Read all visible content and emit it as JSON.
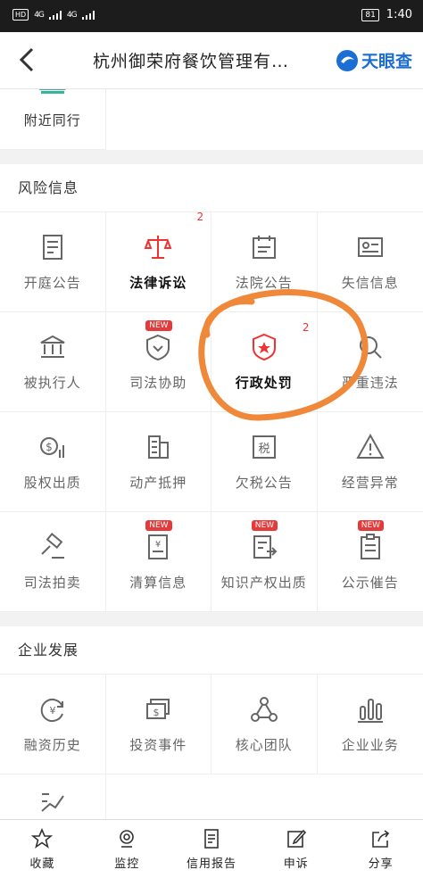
{
  "status_bar": {
    "hd": "HD",
    "sig1": "4G",
    "sig2": "4G",
    "battery": "81",
    "time": "1:40"
  },
  "nav": {
    "title": "杭州御荣府餐饮管理有…",
    "logo_text": "天眼查"
  },
  "top_partial": {
    "items": [
      {
        "label": "附近同行",
        "icon": "map-pin-icon"
      }
    ]
  },
  "risk": {
    "title": "风险信息",
    "items": [
      {
        "label": "开庭公告",
        "icon": "court-notice-icon"
      },
      {
        "label": "法律诉讼",
        "icon": "scales-icon",
        "count": "2",
        "bold": true
      },
      {
        "label": "法院公告",
        "icon": "calendar-icon"
      },
      {
        "label": "失信信息",
        "icon": "id-card-icon"
      },
      {
        "label": "被执行人",
        "icon": "bank-icon"
      },
      {
        "label": "司法协助",
        "icon": "shield-heart-icon",
        "badge": "NEW"
      },
      {
        "label": "行政处罚",
        "icon": "badge-star-icon",
        "count": "2",
        "bold": true
      },
      {
        "label": "严重违法",
        "icon": "search-doc-icon"
      },
      {
        "label": "股权出质",
        "icon": "dollar-chart-icon"
      },
      {
        "label": "动产抵押",
        "icon": "building-icon"
      },
      {
        "label": "欠税公告",
        "icon": "tax-icon"
      },
      {
        "label": "经营异常",
        "icon": "warning-icon"
      },
      {
        "label": "司法拍卖",
        "icon": "gavel-icon"
      },
      {
        "label": "清算信息",
        "icon": "yen-doc-icon",
        "badge": "NEW"
      },
      {
        "label": "知识产权出质",
        "icon": "ip-doc-icon",
        "badge": "NEW"
      },
      {
        "label": "公示催告",
        "icon": "clipboard-icon",
        "badge": "NEW"
      }
    ]
  },
  "development": {
    "title": "企业发展",
    "items": [
      {
        "label": "融资历史",
        "icon": "yen-cycle-icon"
      },
      {
        "label": "投资事件",
        "icon": "dollar-cards-icon"
      },
      {
        "label": "核心团队",
        "icon": "team-icon"
      },
      {
        "label": "企业业务",
        "icon": "bar-chart-icon"
      }
    ]
  },
  "bottom_tabs": [
    {
      "label": "收藏",
      "icon": "star-icon"
    },
    {
      "label": "监控",
      "icon": "camera-icon"
    },
    {
      "label": "信用报告",
      "icon": "report-icon"
    },
    {
      "label": "申诉",
      "icon": "edit-icon"
    },
    {
      "label": "分享",
      "icon": "share-icon"
    }
  ],
  "colors": {
    "accent_red": "#e33333",
    "brand_blue": "#1c6ed4",
    "annotation_orange": "#f0883a"
  }
}
